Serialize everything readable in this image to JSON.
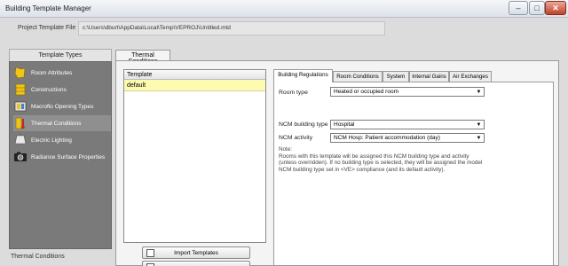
{
  "window": {
    "title": "Building Template Manager",
    "min": "–",
    "max": "□",
    "close": "✕"
  },
  "project": {
    "label": "Project Template File",
    "path": "c:\\Users\\dburt\\AppData\\Local\\Temp\\VEPROJ\\Untitled.mtd"
  },
  "left_panel": {
    "header": "Template Types",
    "items": [
      {
        "label": "Room Attributes",
        "icon": "room-attributes-icon"
      },
      {
        "label": "Constructions",
        "icon": "constructions-icon"
      },
      {
        "label": "Macroflo Opening Types",
        "icon": "opening-types-icon"
      },
      {
        "label": "Thermal Conditions",
        "icon": "thermal-conditions-icon"
      },
      {
        "label": "Electric Lighting",
        "icon": "lighting-icon"
      },
      {
        "label": "Radiance Surface Properties",
        "icon": "camera-icon"
      }
    ],
    "selected_index": 3
  },
  "status": "Thermal Conditions",
  "main_tab": "Thermal Conditions",
  "template_list": {
    "header": "Template",
    "rows": [
      "default"
    ]
  },
  "buttons": {
    "import": "Import Templates"
  },
  "subtabs": [
    "Building Regulations",
    "Room Conditions",
    "System",
    "Internal Gains",
    "Air Exchanges"
  ],
  "form": {
    "room_type": {
      "label": "Room type",
      "value": "Heated or occupied room"
    },
    "ncm_building_type": {
      "label": "NCM building type",
      "value": "Hospital"
    },
    "ncm_activity": {
      "label": "NCM activity",
      "value": "NCM Hosp: Patient accommodation (day)"
    }
  },
  "note": {
    "title": "Note:",
    "lines": [
      "Rooms with this template will be assigned this NCM building type and activity",
      "(unless overridden). If no building type is selected, they will be assigned the model",
      "NCM building type set in <VE> compliance (and its default activity)."
    ]
  }
}
